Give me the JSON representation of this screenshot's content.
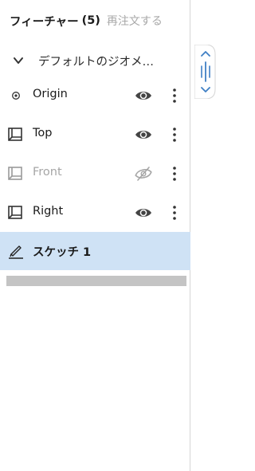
{
  "header": {
    "title": "フィーチャー",
    "count": "(5)",
    "reorder": "再注文する"
  },
  "folder": {
    "label": "デフォルトのジオメ…"
  },
  "features": [
    {
      "name": "Origin",
      "icon": "origin-icon",
      "visible": true
    },
    {
      "name": "Top",
      "icon": "plane-icon",
      "visible": true
    },
    {
      "name": "Front",
      "icon": "plane-icon",
      "visible": false
    },
    {
      "name": "Right",
      "icon": "plane-icon",
      "visible": true
    },
    {
      "name": "スケッチ 1",
      "icon": "sketch-pencil-icon",
      "selected": true
    }
  ],
  "colors": {
    "selected_row": "#cfe2f5",
    "accent": "#3f7fc4",
    "muted_text": "#a6a6a6"
  }
}
